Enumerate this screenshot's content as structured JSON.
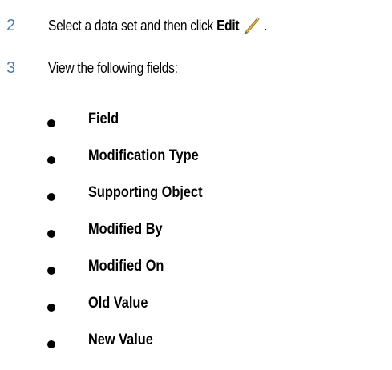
{
  "steps": [
    {
      "number": "2",
      "text_before": "Select a data set and then click ",
      "bold_text": "Edit",
      "text_after": ".",
      "icon": "pencil-icon"
    },
    {
      "number": "3",
      "text": "View the following fields:"
    }
  ],
  "fields": [
    "Field",
    "Modification Type",
    "Supporting Object",
    "Modified By",
    "Modified On",
    "Old Value",
    "New Value"
  ],
  "colors": {
    "step_number": "#4a7fae",
    "text": "#000000",
    "pencil_body": "#f0b93a",
    "pencil_tip": "#6b6b6b"
  }
}
